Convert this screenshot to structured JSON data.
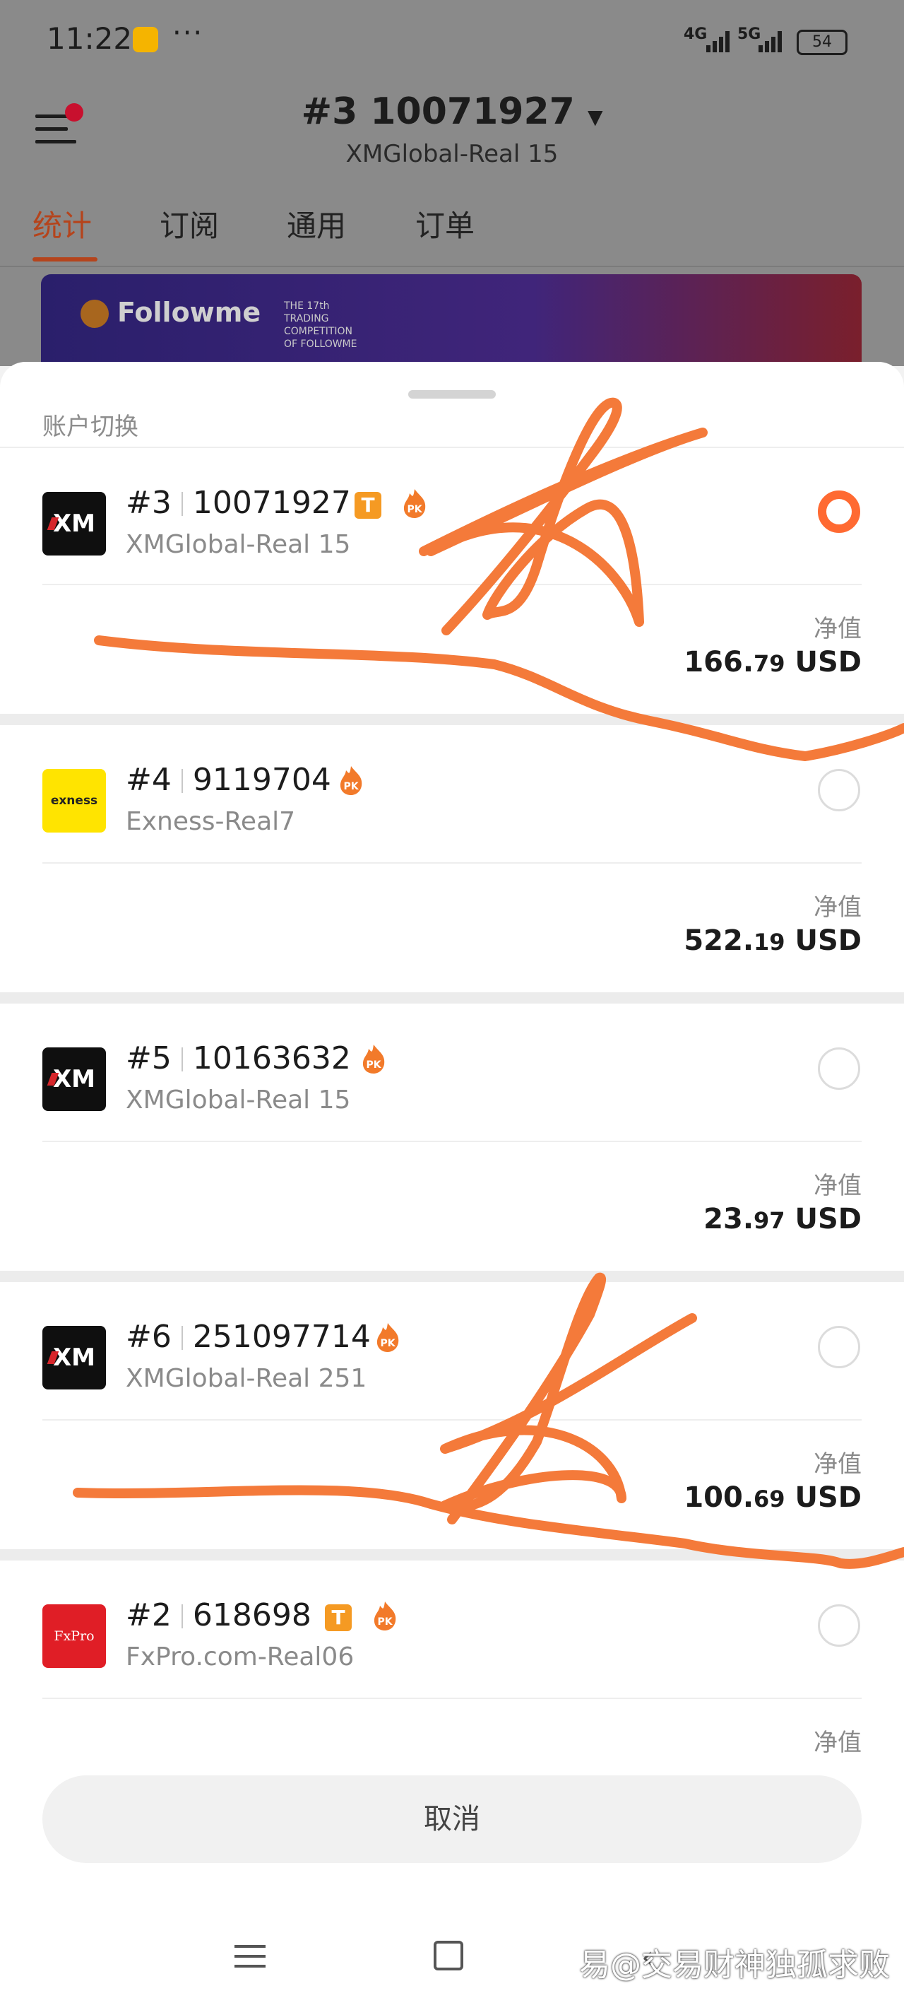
{
  "status": {
    "time": "11:22",
    "more": "···",
    "net1": "4G",
    "net2": "5G",
    "battery": "54"
  },
  "header": {
    "account_title": "#3  10071927",
    "server": "XMGlobal-Real 15",
    "tabs": [
      "统计",
      "订阅",
      "通用",
      "订单"
    ],
    "active_tab": "统计"
  },
  "banner": {
    "brand": "Followme",
    "sub": "THE 17th TRADING COMPETITION OF FOLLOWME"
  },
  "sheet": {
    "title": "账户切换",
    "equity_label": "净值",
    "cancel_label": "取消",
    "accounts": [
      {
        "index": "#3",
        "number": "10071927",
        "server": "XMGlobal-Real 15",
        "broker_logo": "XM",
        "has_t_badge": true,
        "badge_t": "T",
        "badge_pk": "PK",
        "equity_int": "166.",
        "equity_dec": "79",
        "currency": "USD",
        "selected": true
      },
      {
        "index": "#4",
        "number": "9119704",
        "server": "Exness-Real7",
        "broker_logo": "exness",
        "has_t_badge": false,
        "badge_pk": "PK",
        "equity_int": "522.",
        "equity_dec": "19",
        "currency": "USD",
        "selected": false
      },
      {
        "index": "#5",
        "number": "10163632",
        "server": "XMGlobal-Real 15",
        "broker_logo": "XM",
        "has_t_badge": false,
        "badge_pk": "PK",
        "equity_int": "23.",
        "equity_dec": "97",
        "currency": "USD",
        "selected": false
      },
      {
        "index": "#6",
        "number": "251097714",
        "server": "XMGlobal-Real 251",
        "broker_logo": "XM",
        "has_t_badge": false,
        "badge_pk": "PK",
        "equity_int": "100.",
        "equity_dec": "69",
        "currency": "USD",
        "selected": false
      },
      {
        "index": "#2",
        "number": "618698",
        "server": "FxPro.com-Real06",
        "broker_logo": "FxPro",
        "has_t_badge": true,
        "badge_t": "T",
        "badge_pk": "PK",
        "selected": false
      }
    ]
  },
  "watermark": "易@交易财神独孤求败",
  "colors": {
    "accent": "#ff6a32",
    "tab_active": "#b5441c",
    "badge_t": "#f59a23",
    "scribble": "#f47a3a"
  }
}
